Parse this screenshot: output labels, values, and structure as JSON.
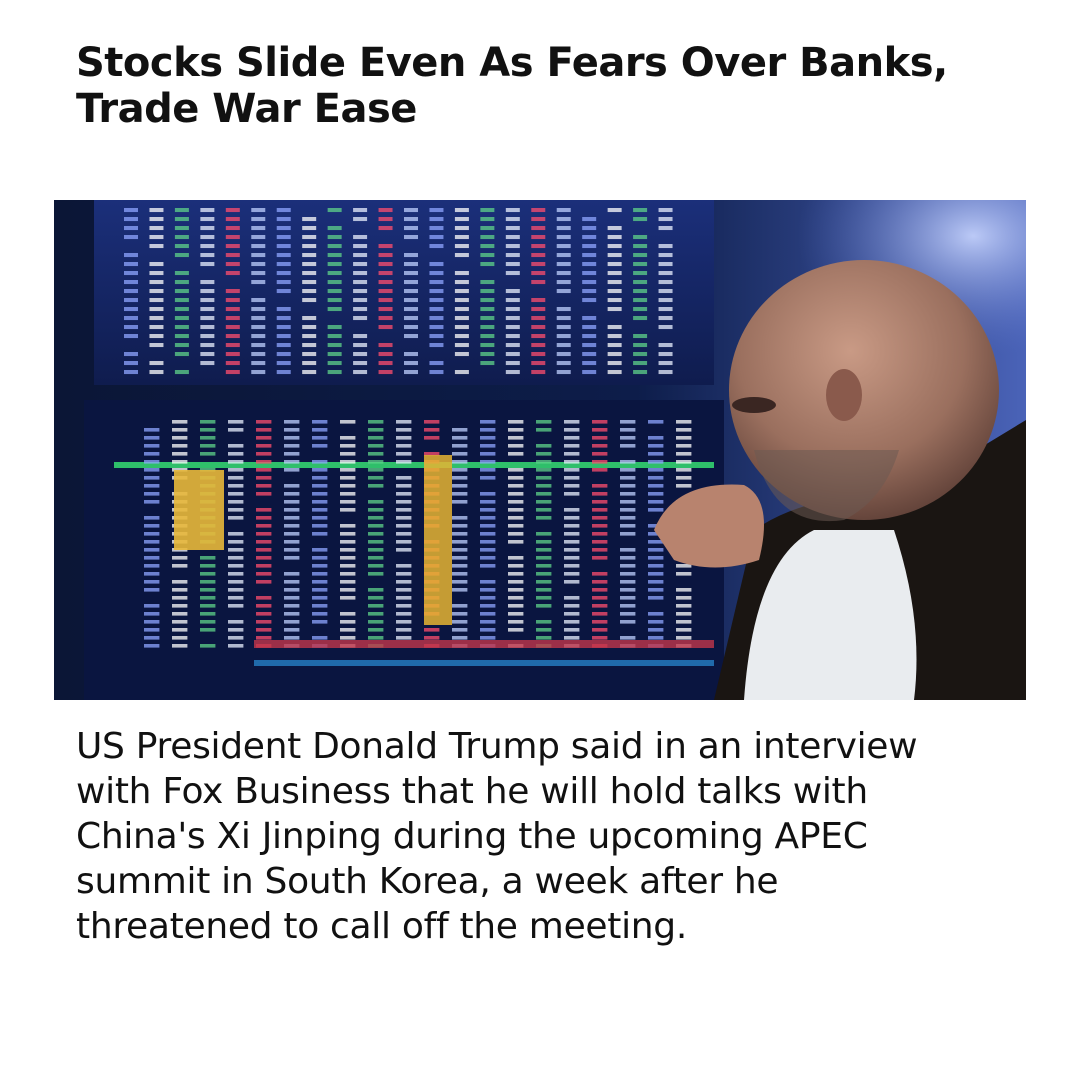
{
  "article": {
    "headline": "Stocks Slide Even As Fears Over Banks, Trade War Ease",
    "image": {
      "subject": "trader-at-screens-photo"
    },
    "body": "US President Donald Trump said in an interview with Fox Business that he will hold talks with China's Xi Jinping during the upcoming APEC summit in South Korea, a week after he threatened to call off the meeting."
  }
}
